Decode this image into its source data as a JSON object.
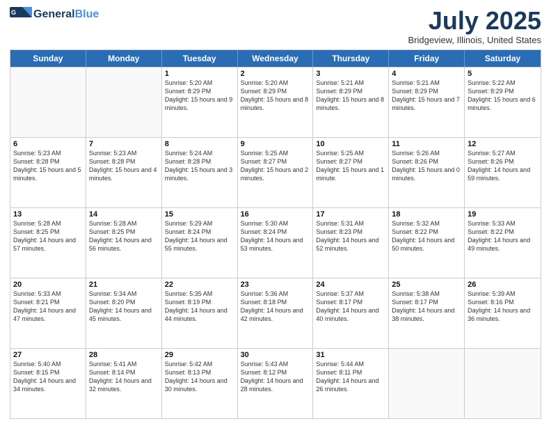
{
  "header": {
    "logo_general": "General",
    "logo_blue": "Blue",
    "month_year": "July 2025",
    "location": "Bridgeview, Illinois, United States"
  },
  "days_of_week": [
    "Sunday",
    "Monday",
    "Tuesday",
    "Wednesday",
    "Thursday",
    "Friday",
    "Saturday"
  ],
  "weeks": [
    [
      {
        "day": "",
        "sunrise": "",
        "sunset": "",
        "daylight": ""
      },
      {
        "day": "",
        "sunrise": "",
        "sunset": "",
        "daylight": ""
      },
      {
        "day": "1",
        "sunrise": "Sunrise: 5:20 AM",
        "sunset": "Sunset: 8:29 PM",
        "daylight": "Daylight: 15 hours and 9 minutes."
      },
      {
        "day": "2",
        "sunrise": "Sunrise: 5:20 AM",
        "sunset": "Sunset: 8:29 PM",
        "daylight": "Daylight: 15 hours and 8 minutes."
      },
      {
        "day": "3",
        "sunrise": "Sunrise: 5:21 AM",
        "sunset": "Sunset: 8:29 PM",
        "daylight": "Daylight: 15 hours and 8 minutes."
      },
      {
        "day": "4",
        "sunrise": "Sunrise: 5:21 AM",
        "sunset": "Sunset: 8:29 PM",
        "daylight": "Daylight: 15 hours and 7 minutes."
      },
      {
        "day": "5",
        "sunrise": "Sunrise: 5:22 AM",
        "sunset": "Sunset: 8:29 PM",
        "daylight": "Daylight: 15 hours and 6 minutes."
      }
    ],
    [
      {
        "day": "6",
        "sunrise": "Sunrise: 5:23 AM",
        "sunset": "Sunset: 8:28 PM",
        "daylight": "Daylight: 15 hours and 5 minutes."
      },
      {
        "day": "7",
        "sunrise": "Sunrise: 5:23 AM",
        "sunset": "Sunset: 8:28 PM",
        "daylight": "Daylight: 15 hours and 4 minutes."
      },
      {
        "day": "8",
        "sunrise": "Sunrise: 5:24 AM",
        "sunset": "Sunset: 8:28 PM",
        "daylight": "Daylight: 15 hours and 3 minutes."
      },
      {
        "day": "9",
        "sunrise": "Sunrise: 5:25 AM",
        "sunset": "Sunset: 8:27 PM",
        "daylight": "Daylight: 15 hours and 2 minutes."
      },
      {
        "day": "10",
        "sunrise": "Sunrise: 5:25 AM",
        "sunset": "Sunset: 8:27 PM",
        "daylight": "Daylight: 15 hours and 1 minute."
      },
      {
        "day": "11",
        "sunrise": "Sunrise: 5:26 AM",
        "sunset": "Sunset: 8:26 PM",
        "daylight": "Daylight: 15 hours and 0 minutes."
      },
      {
        "day": "12",
        "sunrise": "Sunrise: 5:27 AM",
        "sunset": "Sunset: 8:26 PM",
        "daylight": "Daylight: 14 hours and 59 minutes."
      }
    ],
    [
      {
        "day": "13",
        "sunrise": "Sunrise: 5:28 AM",
        "sunset": "Sunset: 8:25 PM",
        "daylight": "Daylight: 14 hours and 57 minutes."
      },
      {
        "day": "14",
        "sunrise": "Sunrise: 5:28 AM",
        "sunset": "Sunset: 8:25 PM",
        "daylight": "Daylight: 14 hours and 56 minutes."
      },
      {
        "day": "15",
        "sunrise": "Sunrise: 5:29 AM",
        "sunset": "Sunset: 8:24 PM",
        "daylight": "Daylight: 14 hours and 55 minutes."
      },
      {
        "day": "16",
        "sunrise": "Sunrise: 5:30 AM",
        "sunset": "Sunset: 8:24 PM",
        "daylight": "Daylight: 14 hours and 53 minutes."
      },
      {
        "day": "17",
        "sunrise": "Sunrise: 5:31 AM",
        "sunset": "Sunset: 8:23 PM",
        "daylight": "Daylight: 14 hours and 52 minutes."
      },
      {
        "day": "18",
        "sunrise": "Sunrise: 5:32 AM",
        "sunset": "Sunset: 8:22 PM",
        "daylight": "Daylight: 14 hours and 50 minutes."
      },
      {
        "day": "19",
        "sunrise": "Sunrise: 5:33 AM",
        "sunset": "Sunset: 8:22 PM",
        "daylight": "Daylight: 14 hours and 49 minutes."
      }
    ],
    [
      {
        "day": "20",
        "sunrise": "Sunrise: 5:33 AM",
        "sunset": "Sunset: 8:21 PM",
        "daylight": "Daylight: 14 hours and 47 minutes."
      },
      {
        "day": "21",
        "sunrise": "Sunrise: 5:34 AM",
        "sunset": "Sunset: 8:20 PM",
        "daylight": "Daylight: 14 hours and 45 minutes."
      },
      {
        "day": "22",
        "sunrise": "Sunrise: 5:35 AM",
        "sunset": "Sunset: 8:19 PM",
        "daylight": "Daylight: 14 hours and 44 minutes."
      },
      {
        "day": "23",
        "sunrise": "Sunrise: 5:36 AM",
        "sunset": "Sunset: 8:18 PM",
        "daylight": "Daylight: 14 hours and 42 minutes."
      },
      {
        "day": "24",
        "sunrise": "Sunrise: 5:37 AM",
        "sunset": "Sunset: 8:17 PM",
        "daylight": "Daylight: 14 hours and 40 minutes."
      },
      {
        "day": "25",
        "sunrise": "Sunrise: 5:38 AM",
        "sunset": "Sunset: 8:17 PM",
        "daylight": "Daylight: 14 hours and 38 minutes."
      },
      {
        "day": "26",
        "sunrise": "Sunrise: 5:39 AM",
        "sunset": "Sunset: 8:16 PM",
        "daylight": "Daylight: 14 hours and 36 minutes."
      }
    ],
    [
      {
        "day": "27",
        "sunrise": "Sunrise: 5:40 AM",
        "sunset": "Sunset: 8:15 PM",
        "daylight": "Daylight: 14 hours and 34 minutes."
      },
      {
        "day": "28",
        "sunrise": "Sunrise: 5:41 AM",
        "sunset": "Sunset: 8:14 PM",
        "daylight": "Daylight: 14 hours and 32 minutes."
      },
      {
        "day": "29",
        "sunrise": "Sunrise: 5:42 AM",
        "sunset": "Sunset: 8:13 PM",
        "daylight": "Daylight: 14 hours and 30 minutes."
      },
      {
        "day": "30",
        "sunrise": "Sunrise: 5:43 AM",
        "sunset": "Sunset: 8:12 PM",
        "daylight": "Daylight: 14 hours and 28 minutes."
      },
      {
        "day": "31",
        "sunrise": "Sunrise: 5:44 AM",
        "sunset": "Sunset: 8:11 PM",
        "daylight": "Daylight: 14 hours and 26 minutes."
      },
      {
        "day": "",
        "sunrise": "",
        "sunset": "",
        "daylight": ""
      },
      {
        "day": "",
        "sunrise": "",
        "sunset": "",
        "daylight": ""
      }
    ]
  ]
}
